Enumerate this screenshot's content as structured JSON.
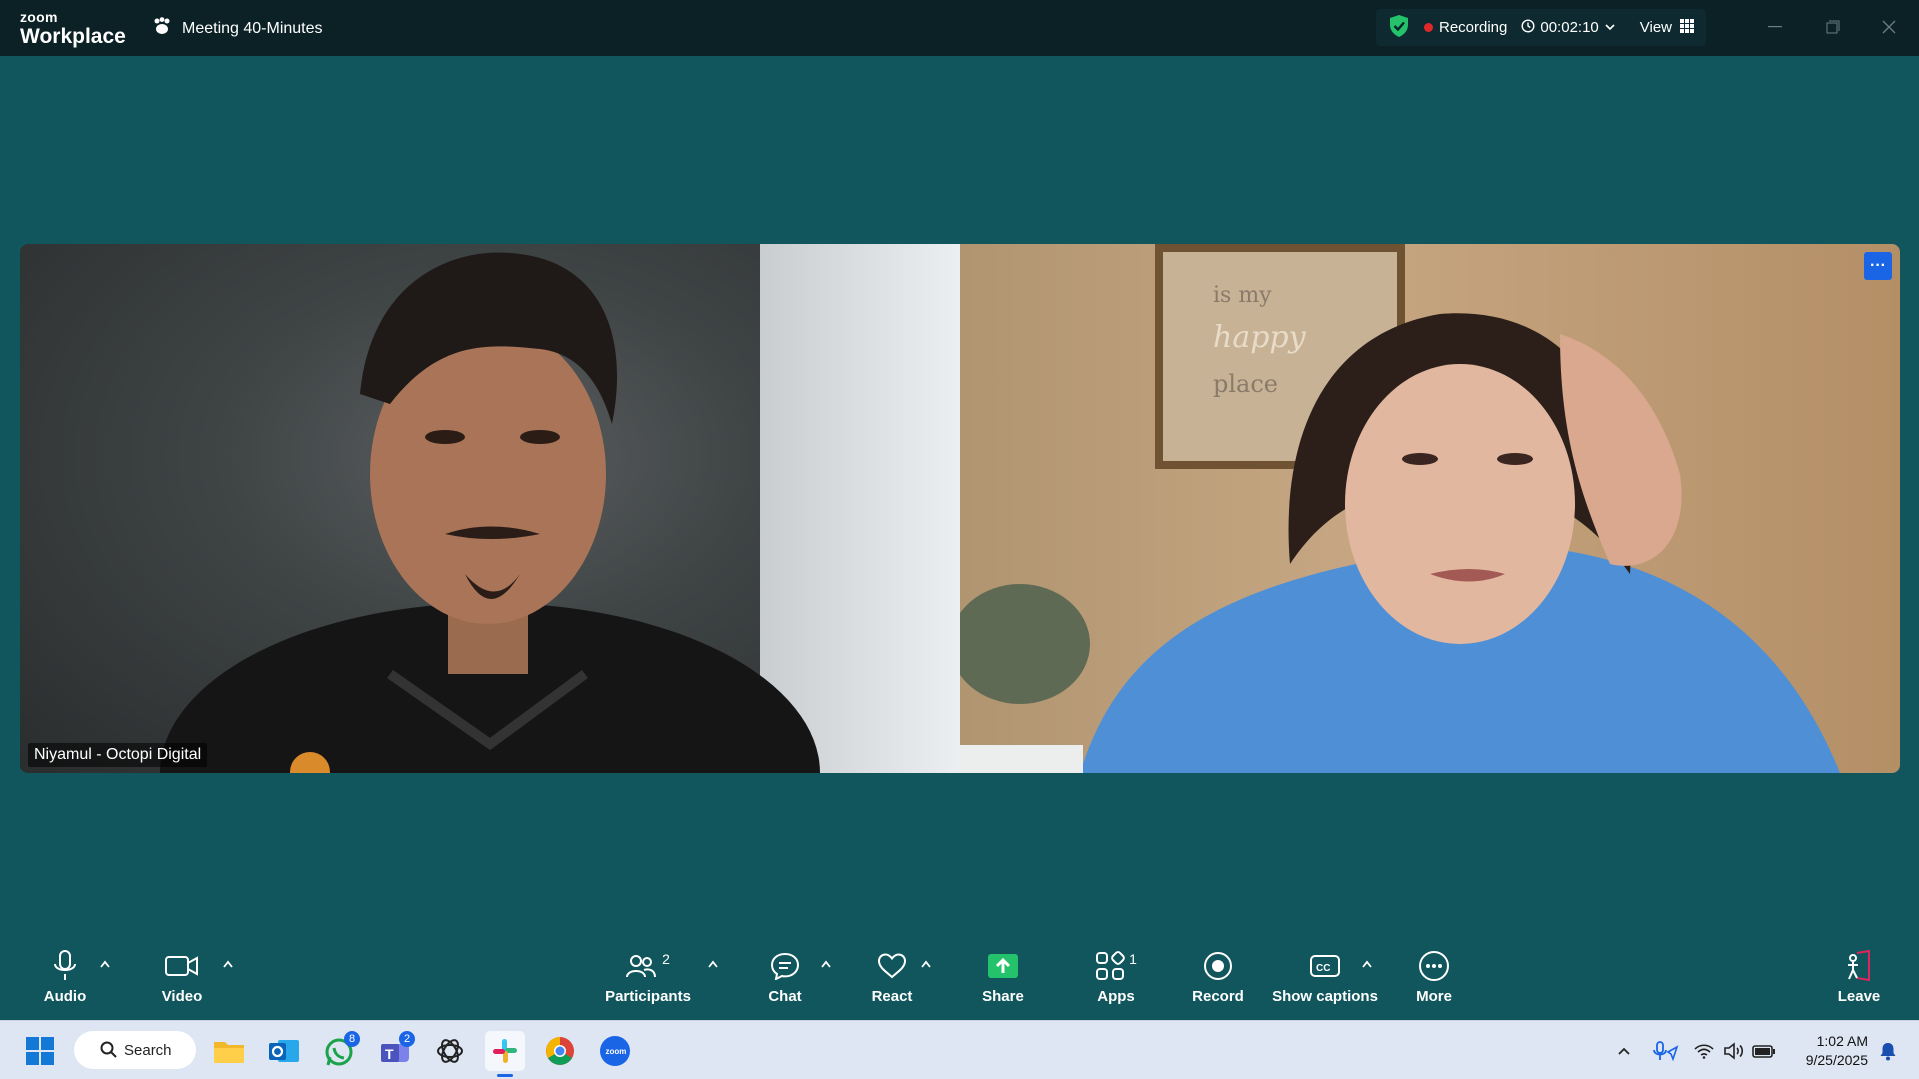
{
  "titlebar": {
    "brand_top": "zoom",
    "brand_bottom": "Workplace",
    "meeting_title": "Meeting 40-Minutes",
    "recording_label": "Recording",
    "timer": "00:02:10",
    "view_label": "View"
  },
  "participants": [
    {
      "name": "Niyamul - Octopi Digital"
    },
    {
      "name": ""
    }
  ],
  "toolbar": {
    "audio": "Audio",
    "video": "Video",
    "participants": "Participants",
    "participants_count": "2",
    "chat": "Chat",
    "react": "React",
    "share": "Share",
    "apps": "Apps",
    "apps_count": "1",
    "record": "Record",
    "captions": "Show captions",
    "more": "More",
    "leave": "Leave"
  },
  "taskbar": {
    "search": "Search",
    "whatsapp_badge": "8",
    "teams_badge": "2",
    "time": "1:02 AM",
    "date": "9/25/2025"
  },
  "colors": {
    "meeting_bg": "#10565c",
    "titlebar_bg": "#0b2126",
    "share_green": "#23c26b",
    "leave_red": "#e0245e",
    "accent_blue": "#1a64e6"
  }
}
